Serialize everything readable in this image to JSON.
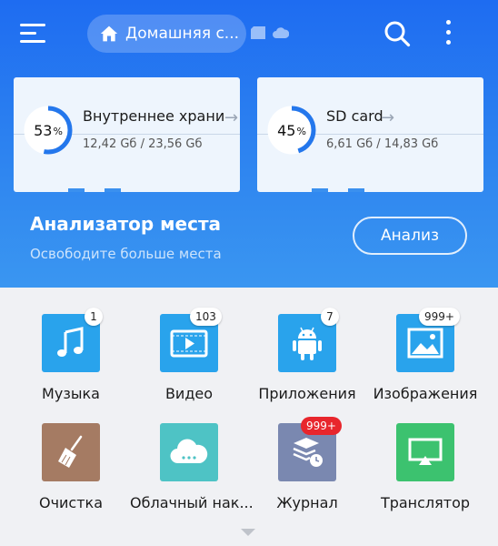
{
  "header": {
    "path_label": "Домашняя с...",
    "icons": [
      "menu-icon",
      "home-icon",
      "sd-card-icon",
      "cloud-icon",
      "search-icon",
      "more-vertical-icon"
    ]
  },
  "storage": [
    {
      "percent": 53,
      "percent_text": "53",
      "percent_sign": "%",
      "name": "Внутреннее храни",
      "size": "12,42 Gб / 23,56 Gб"
    },
    {
      "percent": 45,
      "percent_text": "45",
      "percent_sign": "%",
      "name": "SD card",
      "size": "6,61 Gб / 14,83 Gб"
    }
  ],
  "analyzer": {
    "title": "Анализатор места",
    "subtitle": "Освободите больше места",
    "button": "Анализ"
  },
  "tiles": [
    {
      "label": "Музыка",
      "badge": "1",
      "icon": "music-icon",
      "color": "#29a3ec"
    },
    {
      "label": "Видео",
      "badge": "103",
      "icon": "video-icon",
      "color": "#29a3ec"
    },
    {
      "label": "Приложения",
      "badge": "7",
      "icon": "android-icon",
      "color": "#29a3ec"
    },
    {
      "label": "Изображения",
      "badge": "999+",
      "icon": "image-icon",
      "color": "#29a3ec"
    },
    {
      "label": "Очистка",
      "badge": "",
      "icon": "broom-icon",
      "color": "#a57b63"
    },
    {
      "label": "Облачный нак...",
      "badge": "",
      "icon": "cloud-storage-icon",
      "color": "#4ec3c5"
    },
    {
      "label": "Журнал",
      "badge": "999+",
      "icon": "history-icon",
      "color": "#7a88b0"
    },
    {
      "label": "Транслятор",
      "badge": "",
      "icon": "cast-icon",
      "color": "#3cc26f"
    }
  ],
  "colors": {
    "accent": "#1e6cf1",
    "badge_red": "#e8262c"
  }
}
